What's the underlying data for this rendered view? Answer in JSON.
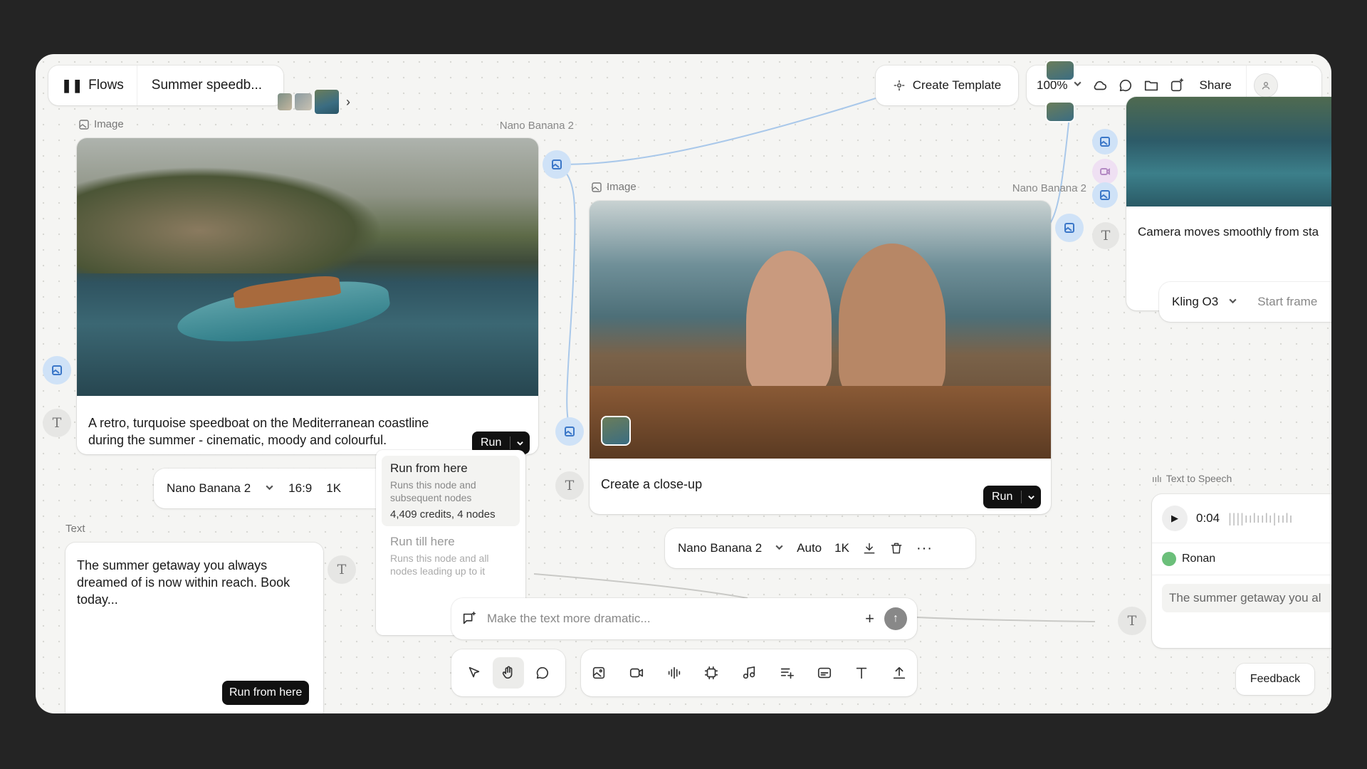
{
  "topbar": {
    "flows_label": "Flows",
    "title": "Summer speedb...",
    "create_template": "Create Template",
    "zoom": "100%",
    "share": "Share"
  },
  "node1": {
    "header": "Image",
    "model": "Nano Banana 2",
    "prompt": "A retro, turquoise speedboat on the Mediterranean coastline during the summer - cinematic, moody and colourful.",
    "run": "Run",
    "settings": {
      "model": "Nano Banana 2",
      "ratio": "16:9",
      "res": "1K"
    }
  },
  "run_menu": {
    "item1_title": "Run from here",
    "item1_desc": "Runs this node and subsequent nodes",
    "item1_credits": "4,409 credits, 4 nodes",
    "item2_title": "Run till here",
    "item2_desc": "Runs this node and all nodes leading up to it"
  },
  "node2": {
    "header": "Image",
    "model": "Nano Banana 2",
    "prompt": "Create a close-up",
    "run": "Run",
    "settings": {
      "model": "Nano Banana 2",
      "ratio": "Auto",
      "res": "1K"
    }
  },
  "text_node": {
    "header": "Text",
    "body": "The summer getaway you always dreamed of is now within reach. Book today...",
    "run_button": "Run from here"
  },
  "video_node": {
    "prompt": "Camera moves smoothly from sta",
    "model": "Kling O3",
    "frame": "Start frame"
  },
  "tts_node": {
    "header": "Text to Speech",
    "time": "0:04",
    "voice": "Ronan",
    "text": "The summer getaway you al"
  },
  "prompt_bar": {
    "placeholder": "Make the text more dramatic..."
  },
  "feedback": "Feedback",
  "colors": {
    "port_blue": "#cfe2f7",
    "accent": "#3b77c8",
    "dark": "#111111"
  }
}
